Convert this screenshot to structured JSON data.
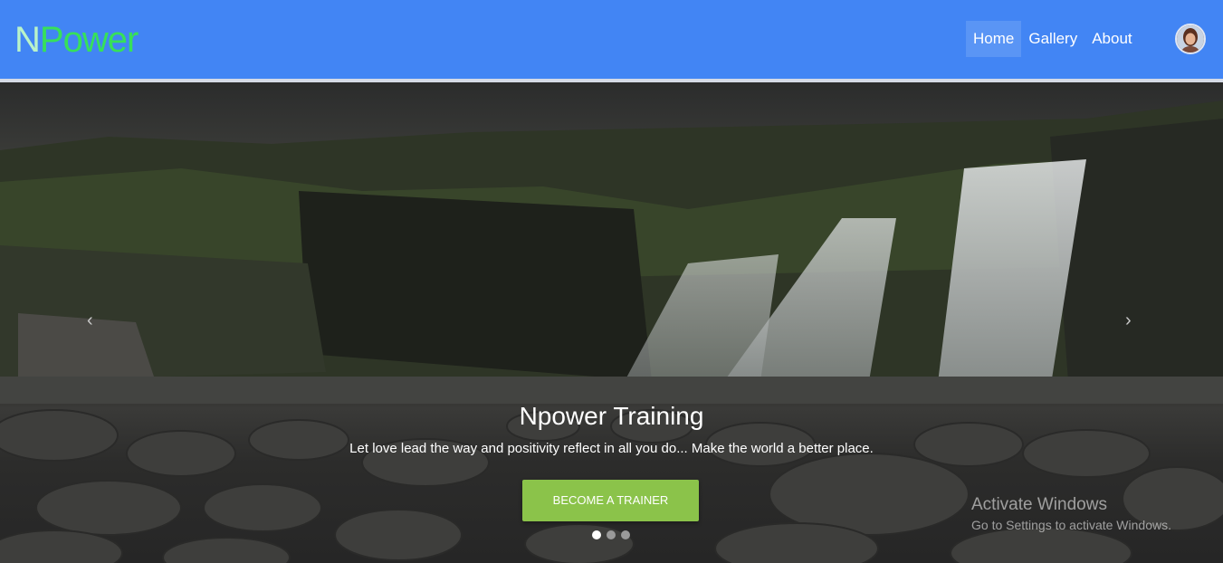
{
  "brand": {
    "first": "N",
    "rest": "Power"
  },
  "nav": {
    "items": [
      {
        "label": "Home",
        "active": true
      },
      {
        "label": "Gallery",
        "active": false
      },
      {
        "label": "About",
        "active": false
      }
    ]
  },
  "carousel": {
    "prev_icon": "‹",
    "next_icon": "›",
    "title": "Npower Training",
    "text": "Let love lead the way and positivity reflect in all you do... Make the world a better place.",
    "cta_label": "BECOME A TRAINER",
    "slide_count": 3,
    "active_slide": 1
  },
  "watermark": {
    "title": "Activate Windows",
    "subtitle": "Go to Settings to activate Windows."
  },
  "colors": {
    "navbar": "#4285f4",
    "brand_n": "#b9f3c9",
    "brand_rest": "#37e05a",
    "cta": "#8bc34a"
  }
}
